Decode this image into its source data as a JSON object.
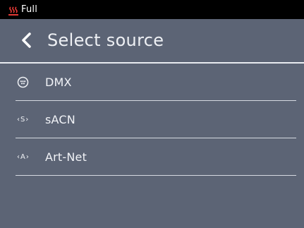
{
  "status": {
    "icon": "heater-icon",
    "text": "Full",
    "icon_color": "#e53935"
  },
  "header": {
    "back_icon": "chevron-left-icon",
    "title": "Select source"
  },
  "sources": [
    {
      "label": "DMX",
      "icon": "dmx-connector-icon",
      "icon_text": ""
    },
    {
      "label": "sACN",
      "icon": "sacn-icon",
      "icon_text": "‹S›"
    },
    {
      "label": "Art-Net",
      "icon": "artnet-icon",
      "icon_text": "‹A›"
    }
  ],
  "colors": {
    "background": "#5c6475",
    "status_bar": "#000000",
    "text": "#eef0f4",
    "divider": "#e8ebf0"
  }
}
